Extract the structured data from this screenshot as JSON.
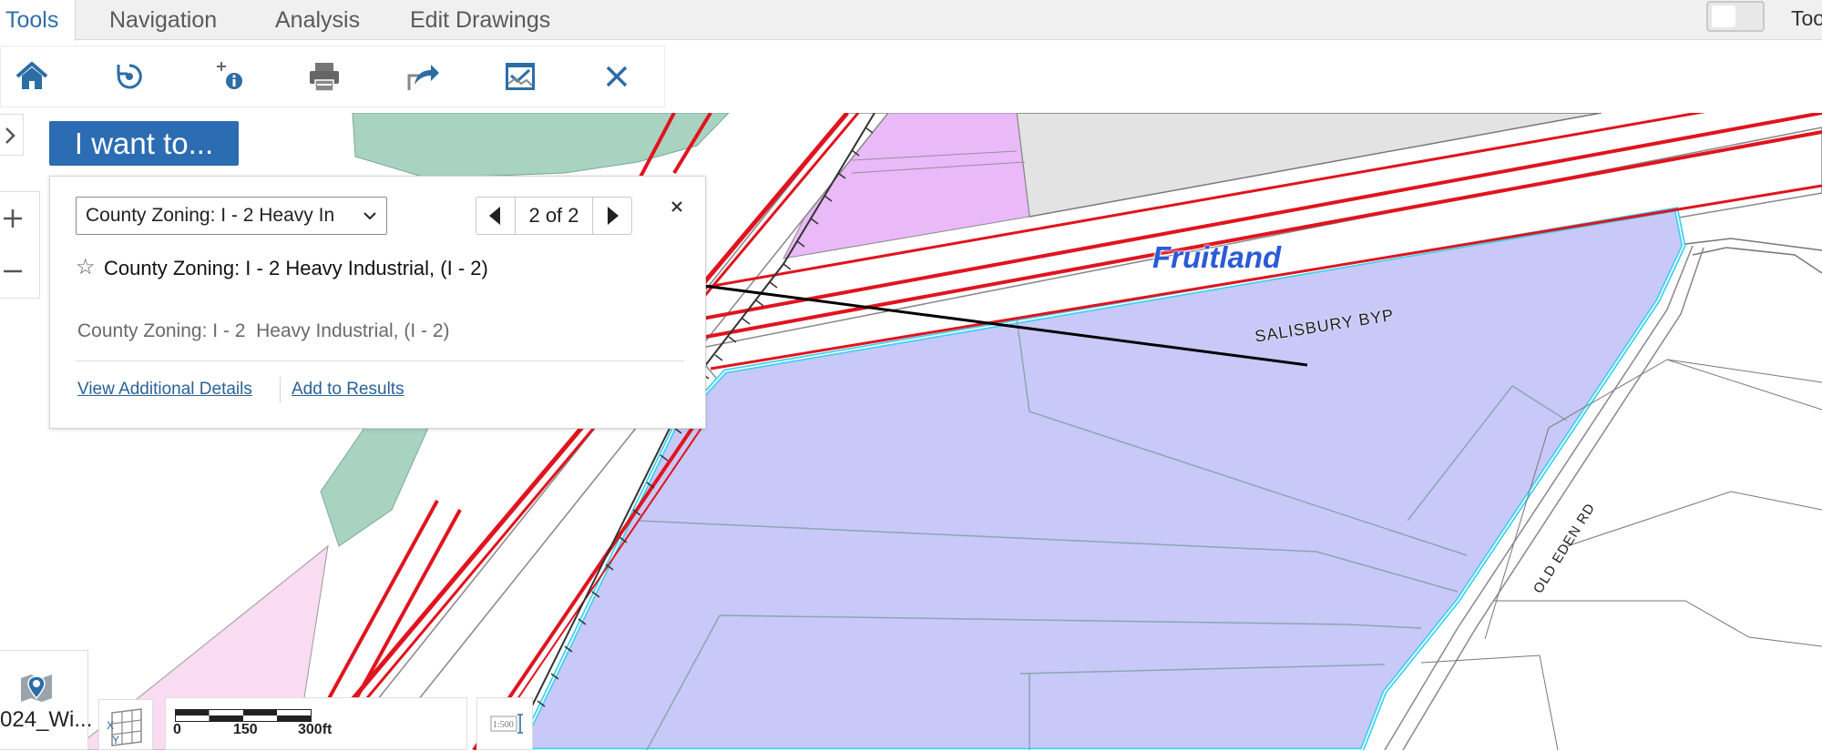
{
  "tabs": [
    {
      "label": "Tools",
      "active": true
    },
    {
      "label": "Navigation",
      "active": false
    },
    {
      "label": "Analysis",
      "active": false
    },
    {
      "label": "Edit Drawings",
      "active": false
    }
  ],
  "header_right": {
    "label": "Too"
  },
  "toolbar": {
    "icons": [
      "home-icon",
      "refresh-icon",
      "identify-icon",
      "print-icon",
      "share-icon",
      "export-icon",
      "close-icon"
    ]
  },
  "iwant": {
    "label": "I want to..."
  },
  "popup": {
    "select_value": "County Zoning: I - 2 Heavy In",
    "pager_text": "2 of 2",
    "star": "☆",
    "title": "County Zoning: I - 2 Heavy Industrial, (I - 2)",
    "description": "County Zoning: I - 2  Heavy Industrial, (I - 2)",
    "link_details": "View Additional Details",
    "link_results": "Add to Results"
  },
  "map": {
    "place_label": "Fruitland",
    "road_label_1": "SALISBURY BYP",
    "road_label_2": "OLD EDEN RD",
    "zone_colors": {
      "industrial": "#c8c9f8",
      "green": "#a9d3c1",
      "commercial": "#e9baf7",
      "residential": "#f9dcf1",
      "municipal": "#e3e3e3",
      "highlight": "#3fd0f0",
      "road": "#e0141e"
    }
  },
  "basemap": {
    "label": "024_Wi..."
  },
  "scale": {
    "labels": [
      "0",
      "150",
      "300ft"
    ],
    "scale_text": "1:500"
  }
}
